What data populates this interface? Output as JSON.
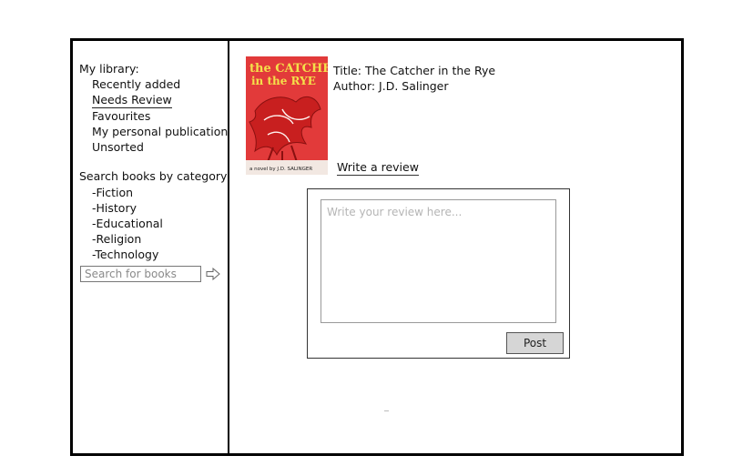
{
  "sidebar": {
    "library_title": "My library:",
    "library_items": [
      "Recently added",
      "Needs Review",
      "Favourites",
      "My personal publication",
      "Unsorted"
    ],
    "category_title": "Search books by category:",
    "categories": [
      "-Fiction",
      "-History",
      "-Educational",
      "-Religion",
      "-Technology"
    ],
    "search_placeholder": "Search for books"
  },
  "book": {
    "cover_title_line1": "the CATCHER",
    "cover_title_line2": "in the RYE",
    "cover_author": "a novel by J.D. SALINGER",
    "title": "Title: The Catcher in the Rye",
    "author": "Author: J.D. Salinger"
  },
  "review": {
    "write_link": "Write a review",
    "placeholder": "Write your review here...",
    "post_label": "Post"
  },
  "colors": {
    "cover_red": "#e23a3a",
    "cover_title_yellow": "#f4e04a",
    "frame": "#000000"
  },
  "icons": {
    "search_submit": "arrow-right-icon"
  }
}
